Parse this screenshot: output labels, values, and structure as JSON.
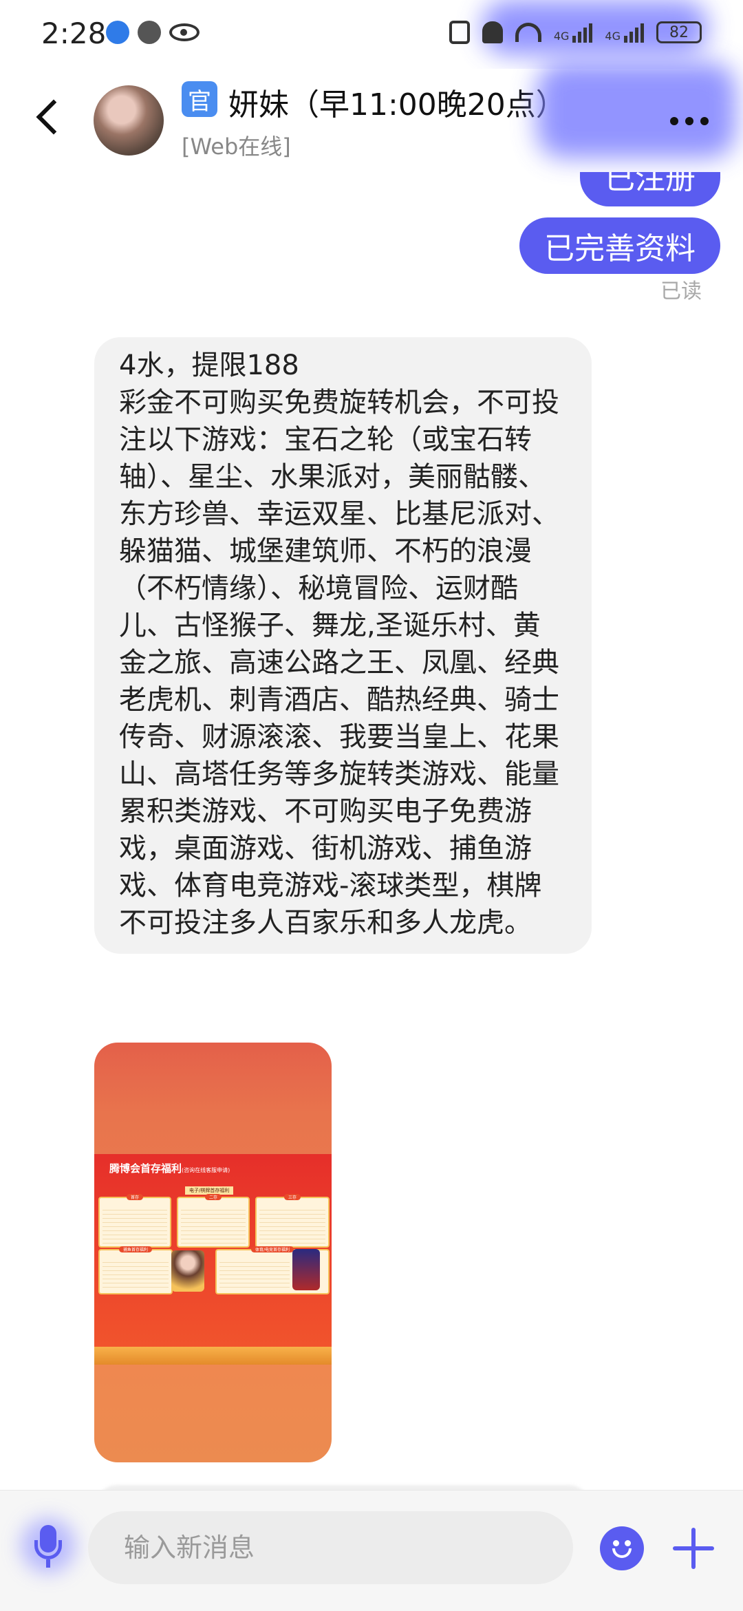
{
  "status_bar": {
    "time": "2:28",
    "network_1": "4G",
    "network_2": "4G",
    "battery": "82"
  },
  "header": {
    "badge": "官",
    "contact_name": "妍妹（早11:00晚20点）",
    "contact_status": "[Web在线]"
  },
  "messages": {
    "outgoing_1": "已注册",
    "outgoing_2": "已完善资料",
    "read_receipt": "已读",
    "incoming_lines": [
      "4水，提限188",
      "彩金不可购买免费旋转机会，不可投注以下游戏：宝石之轮（或宝石转轴）、星尘、水果派对，美丽骷髅、东方珍兽、幸运双星、比基尼派对、躲猫猫、城堡建筑师、不朽的浪漫（不朽情缘）、秘境冒险、运财酷儿、古怪猴子、舞龙,圣诞乐村、黄金之旅、高速公路之王、凤凰、经典老虎机、刺青酒店、酷热经典、骑士传奇、财源滚滚、我要当皇上、花果山、高塔任务等多旋转类游戏、能量累积类游戏、不可购买电子免费游戏，桌面游戏、街机游戏、捕鱼游戏、体育电竞游戏-滚球类型，棋牌不可投注多人百家乐和多人龙虎。"
    ],
    "image_poster": {
      "title": "腾博会首存福利",
      "title_note": "(咨询在线客服申请)",
      "subtitle": "电子/棋牌首存福利",
      "cards": [
        "首存",
        "二存",
        "三存",
        "捕鱼首存福利",
        "体育/电竞首存福利"
      ]
    }
  },
  "input_bar": {
    "placeholder": "输入新消息"
  },
  "colors": {
    "accent": "#5a5cf0",
    "bubble_in": "#f2f2f2",
    "official_badge": "#4a8df0"
  }
}
